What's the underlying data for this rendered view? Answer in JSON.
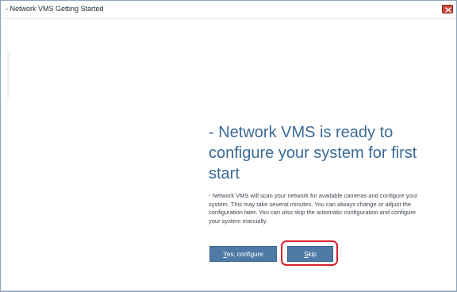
{
  "window": {
    "title": "- Network VMS Getting Started"
  },
  "main": {
    "heading": "- Network VMS is ready to configure your system for first start",
    "description": "- Network VMS will scan your network for available cameras and configure your system. This may take several minutes. You can always change or adjust the configuration later. You can also skip the automatic configuration and configure your system manually.",
    "buttons": {
      "yes_prefix": "Y",
      "yes_rest": "es, configure",
      "skip_prefix": "S",
      "skip_rest": "kip"
    }
  },
  "icons": {
    "close": "close-icon"
  },
  "colors": {
    "heading": "#3b6a96",
    "button": "#4f7aa8",
    "highlight": "#d7202c",
    "close": "#c84a3a"
  }
}
